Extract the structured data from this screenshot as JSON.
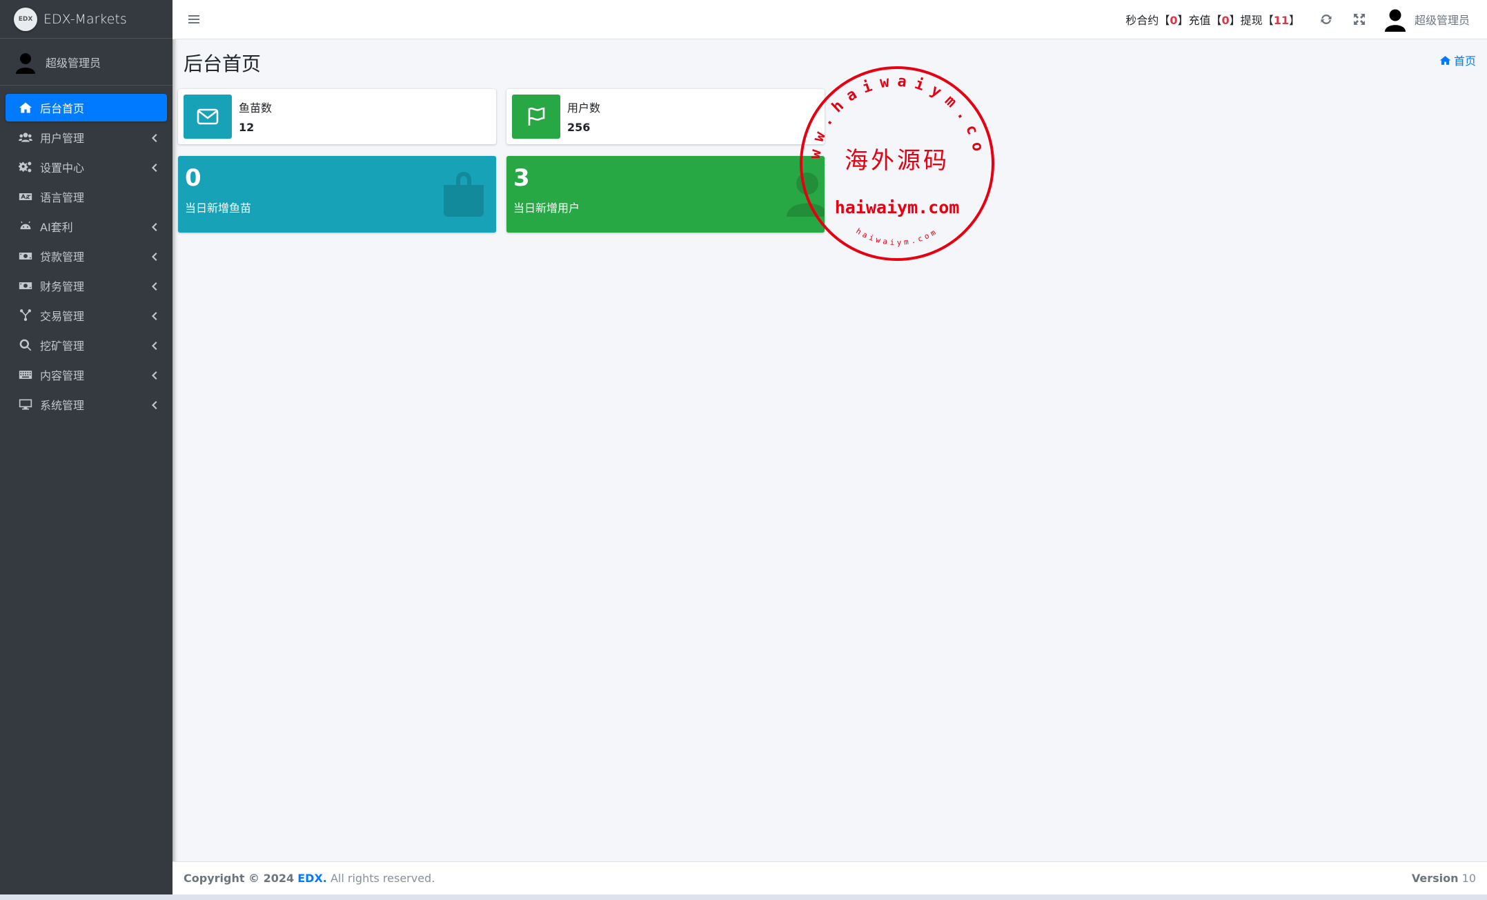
{
  "brand": {
    "logo_text": "EDX",
    "name": "EDX-Markets"
  },
  "sidebar": {
    "user_name": "超级管理员",
    "items": [
      {
        "label": "后台首页",
        "icon": "home-icon",
        "active": true,
        "has_children": false
      },
      {
        "label": "用户管理",
        "icon": "users-icon",
        "has_children": true
      },
      {
        "label": "设置中心",
        "icon": "cogs-icon",
        "has_children": true
      },
      {
        "label": "语言管理",
        "icon": "language-icon",
        "has_children": false
      },
      {
        "label": "AI套利",
        "icon": "android-icon",
        "has_children": true
      },
      {
        "label": "贷款管理",
        "icon": "money-icon",
        "has_children": true
      },
      {
        "label": "财务管理",
        "icon": "money-icon",
        "has_children": true
      },
      {
        "label": "交易管理",
        "icon": "network-icon",
        "has_children": true
      },
      {
        "label": "挖矿管理",
        "icon": "search-icon",
        "has_children": true
      },
      {
        "label": "内容管理",
        "icon": "keyboard-icon",
        "has_children": true
      },
      {
        "label": "系统管理",
        "icon": "desktop-icon",
        "has_children": true
      }
    ]
  },
  "header": {
    "stats": {
      "contract_label": "秒合约",
      "contract_count": "0",
      "recharge_label": "充值",
      "recharge_count": "0",
      "withdraw_label": "提现",
      "withdraw_count": "11",
      "bracket_open": "【",
      "bracket_close": "】"
    },
    "user_name": "超级管理员"
  },
  "content": {
    "page_title": "后台首页",
    "breadcrumb": "首页",
    "info_boxes": [
      {
        "label": "鱼苗数",
        "value": "12",
        "color": "#17a2b8",
        "icon": "envelope-icon"
      },
      {
        "label": "用户数",
        "value": "256",
        "color": "#28a745",
        "icon": "flag-icon"
      }
    ],
    "small_boxes": [
      {
        "value": "0",
        "label": "当日新增鱼苗",
        "color": "#17a2b8",
        "icon": "shopping-bag-icon"
      },
      {
        "value": "3",
        "label": "当日新增用户",
        "color": "#28a745",
        "icon": "user-icon"
      }
    ]
  },
  "watermark": {
    "top_text": "www.haiwaiym.com",
    "center_text": "海外源码",
    "main_text": "haiwaiym.com",
    "bottom_text": "haiwaiym.com",
    "color": "#e60012"
  },
  "footer": {
    "copyright_prefix": "Copyright © 2024",
    "brand": "EDX.",
    "rights": "All rights reserved.",
    "version_label": "Version",
    "version_value": "10"
  }
}
